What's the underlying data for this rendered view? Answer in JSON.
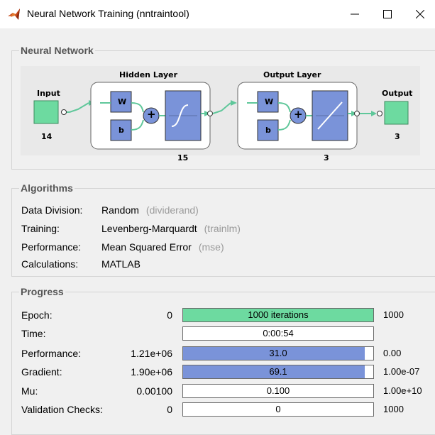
{
  "window": {
    "title": "Neural Network Training (nntraintool)",
    "icon": "matlab-logo-icon",
    "controls": [
      "minimize-icon",
      "maximize-icon",
      "close-icon"
    ]
  },
  "neural_network": {
    "section_title": "Neural Network",
    "input": {
      "label": "Input",
      "size": "14"
    },
    "hidden_layer": {
      "label": "Hidden Layer",
      "weight": "W",
      "bias": "b",
      "sum": "+",
      "size": "15",
      "transfer": "tansig-curve-icon"
    },
    "output_layer": {
      "label": "Output Layer",
      "weight": "W",
      "bias": "b",
      "sum": "+",
      "size": "3",
      "transfer": "linear-curve-icon"
    },
    "output": {
      "label": "Output",
      "size": "3"
    }
  },
  "algorithms": {
    "section_title": "Algorithms",
    "rows": [
      {
        "label": "Data Division:",
        "value": "Random",
        "fn": "(dividerand)"
      },
      {
        "label": "Training:",
        "value": "Levenberg-Marquardt",
        "fn": "(trainlm)"
      },
      {
        "label": "Performance:",
        "value": "Mean Squared Error",
        "fn": "(mse)"
      },
      {
        "label": "Calculations:",
        "value": "MATLAB",
        "fn": ""
      }
    ]
  },
  "progress": {
    "section_title": "Progress",
    "rows": [
      {
        "label": "Epoch:",
        "start": "0",
        "current": "1000 iterations",
        "end": "1000",
        "fill": 1.0,
        "fill_color": "#6ddaa0"
      },
      {
        "label": "Time:",
        "start": "",
        "current": "0:00:54",
        "end": "",
        "fill": 0.0,
        "fill_color": "#7a93d9"
      },
      {
        "label": "Performance:",
        "start": "1.21e+06",
        "current": "31.0",
        "end": "0.00",
        "fill": 0.955,
        "fill_color": "#7a93d9"
      },
      {
        "label": "Gradient:",
        "start": "1.90e+06",
        "current": "69.1",
        "end": "1.00e-07",
        "fill": 0.955,
        "fill_color": "#7a93d9"
      },
      {
        "label": "Mu:",
        "start": "0.00100",
        "current": "0.100",
        "end": "1.00e+10",
        "fill": 0.0,
        "fill_color": "#7a93d9"
      },
      {
        "label": "Validation Checks:",
        "start": "0",
        "current": "0",
        "end": "1000",
        "fill": 0.0,
        "fill_color": "#7a93d9"
      }
    ]
  },
  "colors": {
    "green_node": "#6ddaa0",
    "connector_green": "#5fc79a",
    "weight_block": "#7a93d9",
    "layer_box_fill": "#ffffff",
    "diagram_bg": "#e9e9e9"
  }
}
